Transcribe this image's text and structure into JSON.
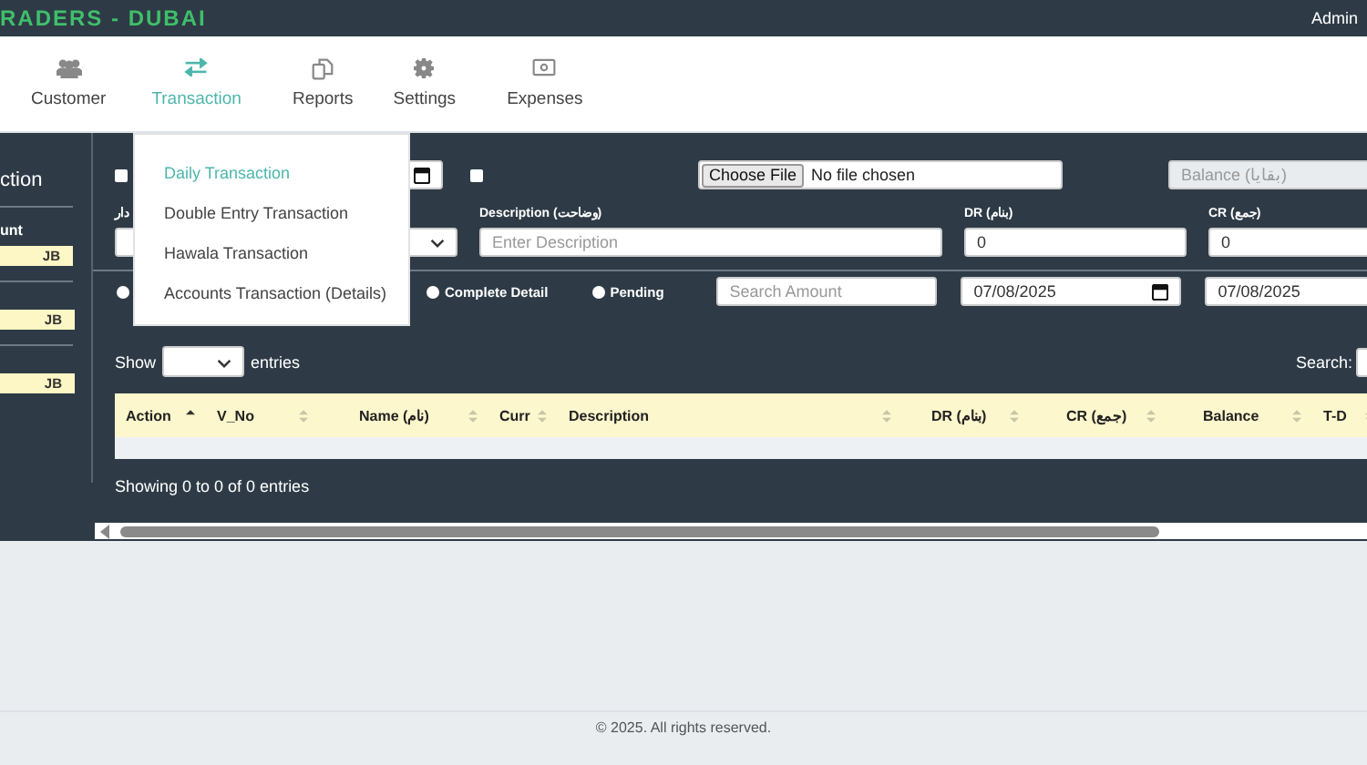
{
  "header": {
    "brand": "RADERS - DUBAI",
    "user": "Admin"
  },
  "nav": [
    {
      "label": "Customer",
      "selected": false
    },
    {
      "label": "Transaction",
      "selected": true
    },
    {
      "label": "Reports",
      "selected": false
    },
    {
      "label": "Settings",
      "selected": false
    },
    {
      "label": "Expenses",
      "selected": false
    }
  ],
  "dropdown": [
    {
      "label": "Daily Transaction",
      "selected": true
    },
    {
      "label": "Double Entry Transaction",
      "selected": false
    },
    {
      "label": "Hawala Transaction",
      "selected": false
    },
    {
      "label": "Accounts Transaction (Details)",
      "selected": false
    }
  ],
  "sidebar": {
    "title": "ction",
    "label": "unt",
    "fields": [
      "JB",
      "JB",
      "JB"
    ]
  },
  "top_row": {
    "checkbox_1": {
      "checked": false
    },
    "checkbox_2": {
      "checked": false
    },
    "file_button": "Choose File",
    "file_status": "No file chosen",
    "balance_placeholder": "Balance (بقايا)"
  },
  "account_select": {
    "label": "دار"
  },
  "description_field": {
    "label": "Description (وضاحت)",
    "placeholder": "Enter Description"
  },
  "dr_field": {
    "label": "DR (بنام)",
    "value": "0"
  },
  "cr_field": {
    "label": "CR (جمع)",
    "value": "0"
  },
  "filters": {
    "radios": [
      {
        "checked": false
      },
      {
        "label": "Complete Detail",
        "checked": false
      },
      {
        "label": "Pending",
        "checked": false
      }
    ],
    "search_amount_placeholder": "Search Amount",
    "date_from": "07/08/2025",
    "date_to": "07/08/2025"
  },
  "table": {
    "show_label": "Show",
    "entries_label": "entries",
    "search_label": "Search:",
    "columns": [
      {
        "label": "Action",
        "sorted": true
      },
      {
        "label": "V_No",
        "sorted": false
      },
      {
        "label": "Name (نام)",
        "sorted": false
      },
      {
        "label": "Curr",
        "sorted": false
      },
      {
        "label": "Description",
        "sorted": false
      },
      {
        "label": "DR (بنام)",
        "sorted": false
      },
      {
        "label": "CR (جمع)",
        "sorted": false
      },
      {
        "label": "Balance",
        "sorted": false
      },
      {
        "label": "T-D",
        "sorted": false
      }
    ],
    "info": "Showing 0 to 0 of 0 entries"
  },
  "footer": "© 2025. All rights reserved."
}
